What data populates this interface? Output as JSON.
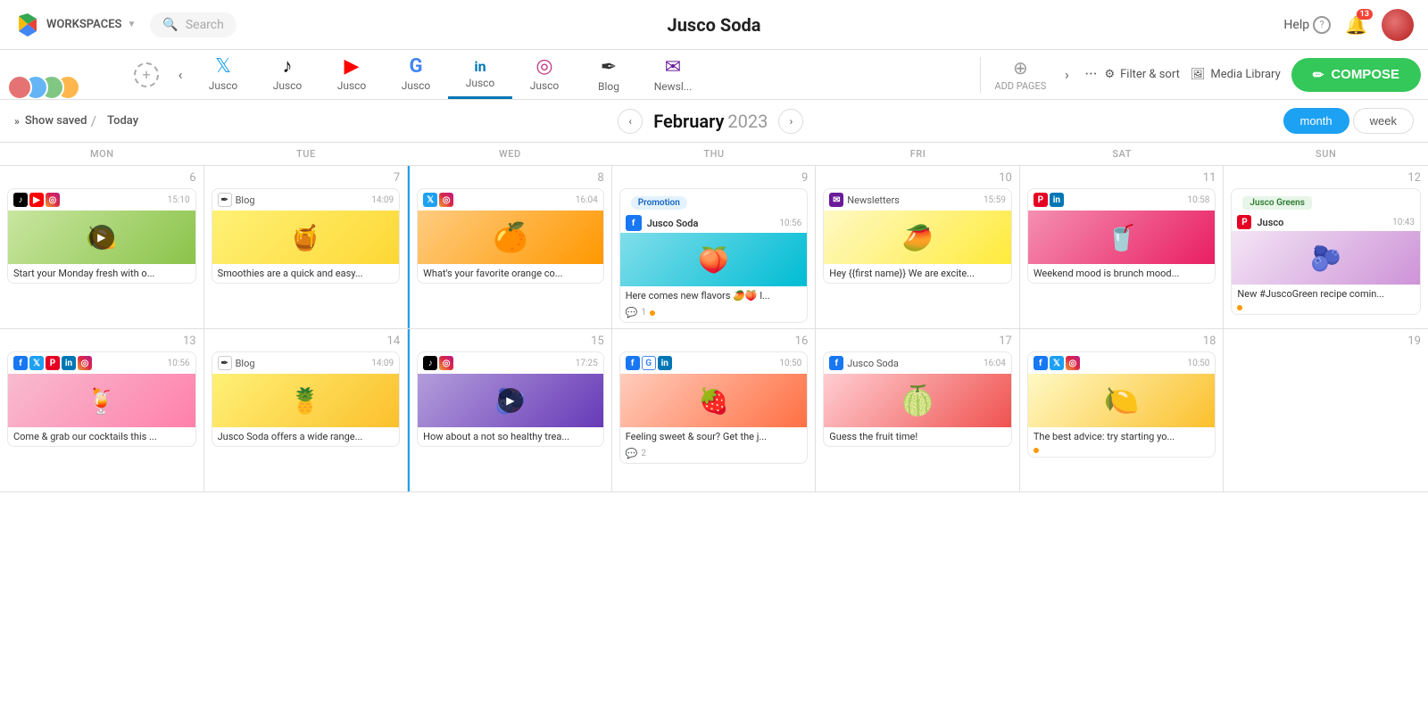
{
  "app": {
    "title": "Jusco Soda",
    "workspace": "WORKSPACES",
    "search_placeholder": "Search",
    "help": "Help"
  },
  "notifications": {
    "count": "13"
  },
  "social_tabs": [
    {
      "id": "twitter",
      "label": "Jusco",
      "icon": "𝕏",
      "active": true,
      "color_class": "twitter-color"
    },
    {
      "id": "tiktok",
      "label": "Jusco",
      "icon": "♪",
      "active": true,
      "color_class": "tiktok-color"
    },
    {
      "id": "youtube",
      "label": "Jusco",
      "icon": "▶",
      "active": true,
      "color_class": "youtube-color"
    },
    {
      "id": "google",
      "label": "Jusco",
      "icon": "G",
      "active": true,
      "color_class": "google-color"
    },
    {
      "id": "linkedin",
      "label": "Jusco",
      "icon": "in",
      "active": true,
      "color_class": "linkedin-color"
    },
    {
      "id": "instagram",
      "label": "Jusco",
      "icon": "◎",
      "active": true,
      "color_class": "instagram-color"
    },
    {
      "id": "blog",
      "label": "Blog",
      "icon": "✒",
      "active": true,
      "color_class": "blog-color"
    },
    {
      "id": "newsletter",
      "label": "Newsl...",
      "icon": "✉",
      "active": true,
      "color_class": "newsletter-color"
    }
  ],
  "add_pages": "ADD PAGES",
  "filter_sort": "Filter & sort",
  "media_library": "Media Library",
  "compose": "COMPOSE",
  "calendar": {
    "show_saved": "Show saved",
    "today": "Today",
    "month": "February",
    "year": "2023",
    "view_month": "month",
    "view_week": "week",
    "days": [
      "MON",
      "TUE",
      "WED",
      "THU",
      "FRI",
      "SAT",
      "SUN"
    ],
    "week1": {
      "dates": [
        6,
        7,
        8,
        9,
        10,
        11,
        12
      ],
      "posts": [
        {
          "day": 0,
          "icons": [
            "tiktok",
            "youtube",
            "instagram"
          ],
          "time": "15:10",
          "bg": "bg-lemon",
          "has_play": true,
          "caption": "Start your Monday fresh with o...",
          "has_footer": false
        },
        {
          "day": 1,
          "icons": [
            "blog"
          ],
          "time": "14:09",
          "bg": "bg-yellow",
          "has_play": false,
          "caption": "Smoothies are a quick and easy...",
          "has_footer": false
        },
        {
          "day": 2,
          "icons": [
            "twitter",
            "instagram"
          ],
          "time": "16:04",
          "bg": "bg-orange",
          "has_play": false,
          "caption": "What's your favorite orange co...",
          "has_footer": false
        },
        {
          "day": 3,
          "tag": "Promotion",
          "tag_type": "promo",
          "sub_name": "Jusco Soda",
          "sub_time": "10:56",
          "bg": "bg-teal",
          "has_play": false,
          "caption": "Here comes new flavors 🥭🍑 l...",
          "has_footer": true,
          "comment_count": "1",
          "has_dot": true,
          "dot_color": "orange"
        },
        {
          "day": 4,
          "icons": [
            "newsletter"
          ],
          "time": "15:59",
          "bg": "bg-mango",
          "has_play": false,
          "caption": "Hey {{first name}} We are excite...",
          "has_footer": false
        },
        {
          "day": 5,
          "icons": [
            "pinterest",
            "linkedin"
          ],
          "time": "10:58",
          "bg": "bg-pink",
          "has_play": false,
          "caption": "Weekend mood is brunch mood...",
          "has_footer": false
        },
        {
          "day": 6,
          "tag": "Jusco Greens",
          "tag_type": "greens",
          "sub_name": "Jusco",
          "sub_time": "10:43",
          "bg": "bg-fig",
          "has_play": false,
          "caption": "New #JuscoGreen recipe comin...",
          "has_footer": true,
          "has_dot": true,
          "dot_color": "orange"
        }
      ]
    },
    "week2": {
      "dates": [
        13,
        14,
        15,
        16,
        17,
        18,
        19
      ],
      "posts": [
        {
          "day": 0,
          "icons": [
            "facebook",
            "twitter",
            "pinterest",
            "linkedin",
            "instagram"
          ],
          "time": "10:56",
          "bg": "bg-cocktail",
          "has_play": false,
          "caption": "Come & grab our cocktails this ...",
          "has_footer": false
        },
        {
          "day": 1,
          "icons": [
            "blog"
          ],
          "time": "14:09",
          "bg": "bg-pineapple",
          "has_play": false,
          "caption": "Jusco Soda offers a wide range...",
          "has_footer": false
        },
        {
          "day": 2,
          "icons": [
            "tiktok",
            "instagram"
          ],
          "time": "17:25",
          "bg": "bg-dark-fruit",
          "has_play": true,
          "caption": "How about a not so healthy trea...",
          "has_footer": false
        },
        {
          "day": 3,
          "icons": [
            "facebook",
            "google",
            "linkedin"
          ],
          "time": "10:50",
          "bg": "bg-fruit",
          "has_play": false,
          "caption": "Feeling sweet & sour? Get the j...",
          "has_footer": true,
          "comment_count": "2",
          "has_dot": false
        },
        {
          "day": 4,
          "icons": [
            "facebook"
          ],
          "sub_name": "Jusco Soda",
          "time": "16:04",
          "bg": "bg-grapefruit",
          "has_play": false,
          "caption": "Guess the fruit time!",
          "has_footer": false
        },
        {
          "day": 5,
          "icons": [
            "facebook",
            "twitter",
            "instagram"
          ],
          "time": "10:50",
          "bg": "bg-citrus",
          "has_play": false,
          "caption": "The best advice: try starting yo...",
          "has_footer": true,
          "has_dot": true,
          "dot_color": "orange"
        },
        {
          "day": 6,
          "empty": true
        }
      ]
    }
  }
}
